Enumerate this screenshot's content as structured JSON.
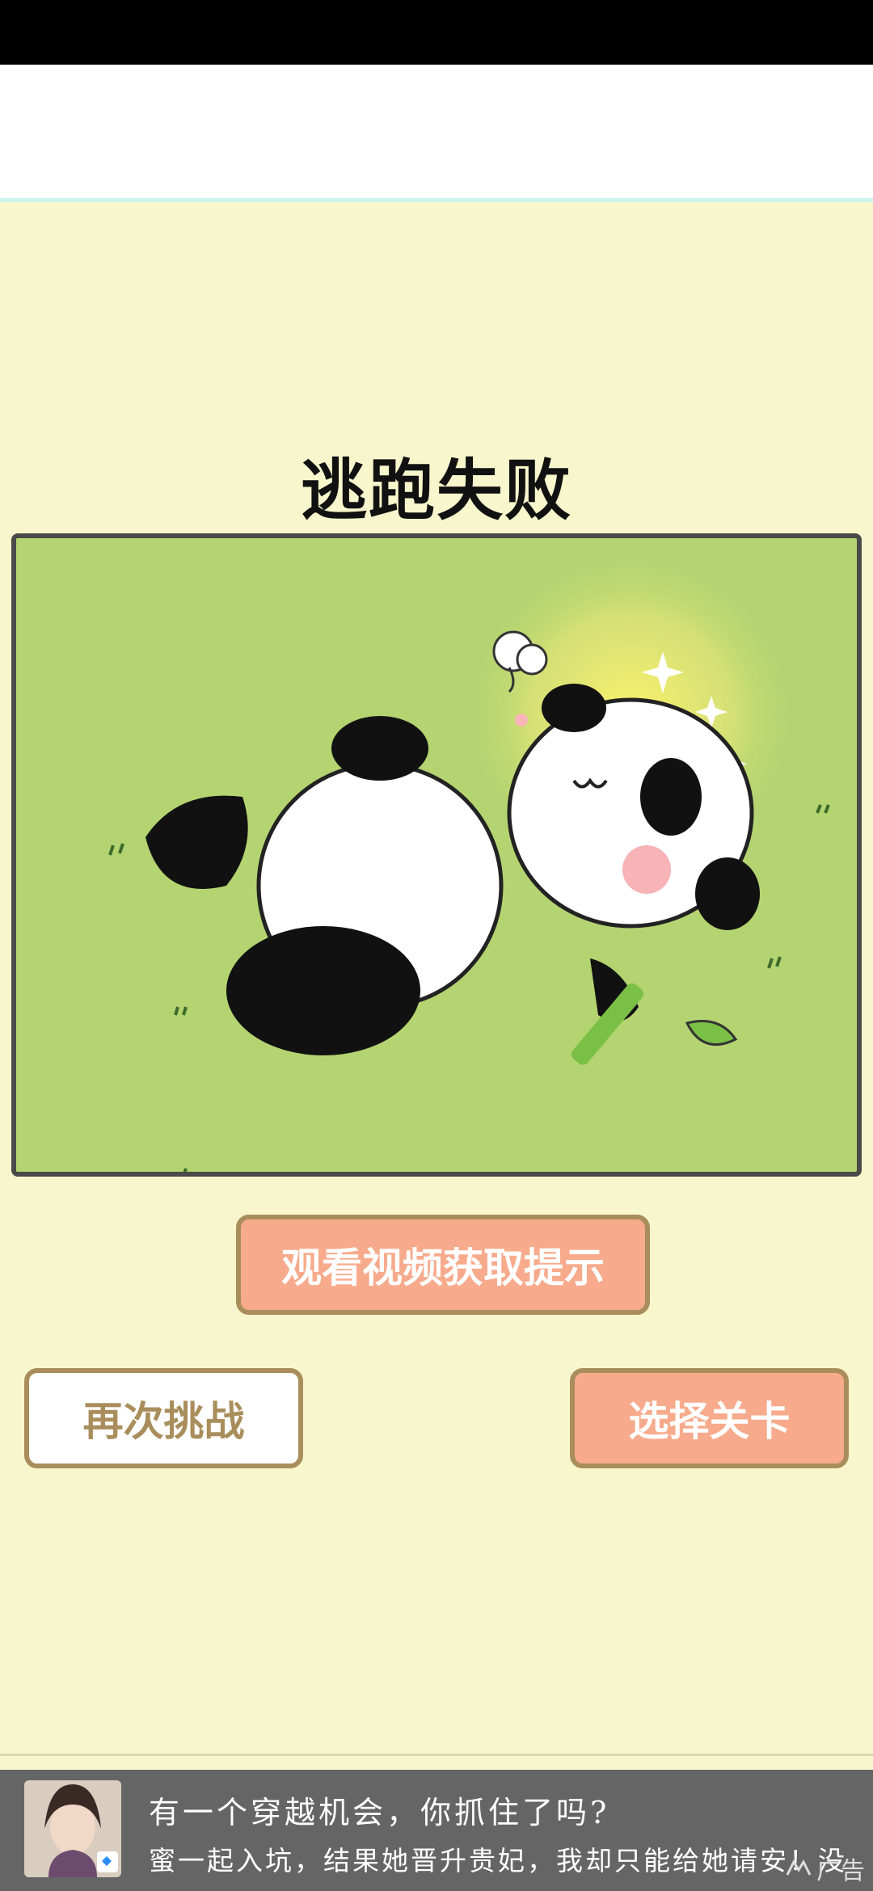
{
  "result": {
    "title": "逃跑失败"
  },
  "buttons": {
    "watch_video": "观看视频获取提示",
    "retry": "再次挑战",
    "select_level": "选择关卡"
  },
  "ad": {
    "title": "有一个穿越机会，你抓住了吗?",
    "description": "蜜一起入坑，结果她晋升贵妃，我却只能给她请安！没",
    "tag": "广告",
    "tag_icon": "ad-brand-icon"
  },
  "colors": {
    "background": "#f8f6cc",
    "button_primary": "#f7ab8c",
    "button_border": "#a98e5c",
    "scene_green": "#b4d471"
  }
}
